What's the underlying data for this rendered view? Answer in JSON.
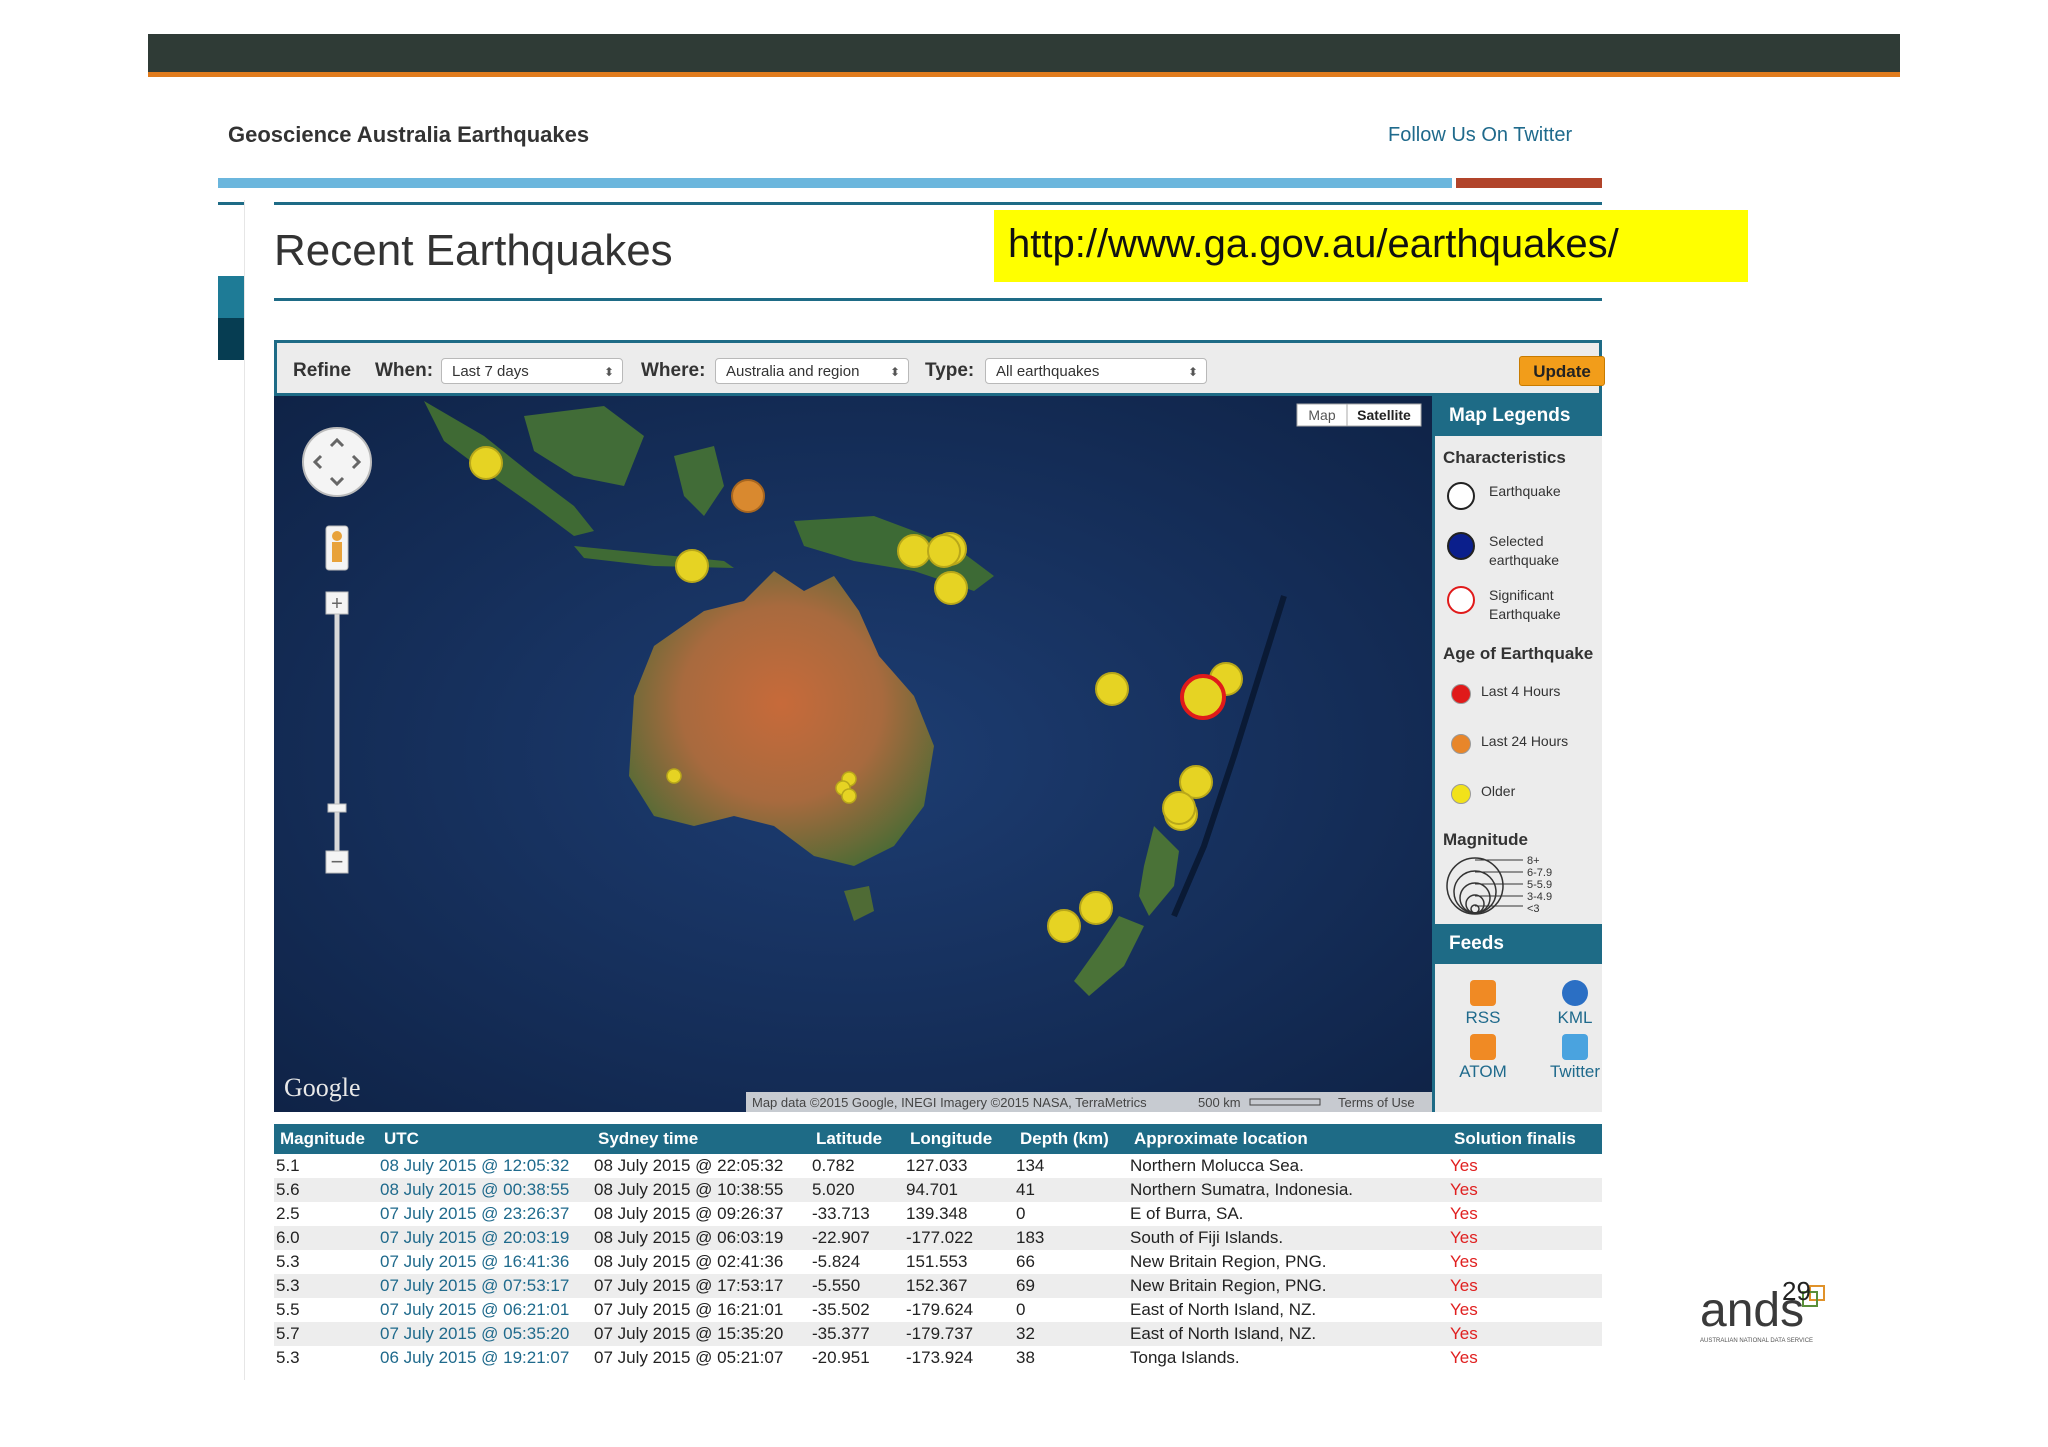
{
  "header": {
    "site_title": "Geoscience Australia Earthquakes",
    "follow_link": "Follow Us On Twitter"
  },
  "page": {
    "heading": "Recent Earthquakes",
    "url_callout": "http://www.ga.gov.au/earthquakes/"
  },
  "refine": {
    "label": "Refine",
    "when_label": "When:",
    "when_value": "Last 7 days",
    "where_label": "Where:",
    "where_value": "Australia and region",
    "type_label": "Type:",
    "type_value": "All earthquakes",
    "update_label": "Update"
  },
  "map": {
    "type_buttons": [
      "Map",
      "Satellite"
    ],
    "attribution": "Map data ©2015 Google, INEGI Imagery ©2015 NASA, TerraMetrics",
    "scale": "500 km",
    "terms": "Terms of Use",
    "brand": "Google",
    "zoom_in": "+",
    "zoom_out": "−"
  },
  "legend": {
    "title": "Map Legends",
    "characteristics_title": "Characteristics",
    "characteristics": [
      "Earthquake",
      "Selected earthquake",
      "Significant Earthquake"
    ],
    "age_title": "Age of Earthquake",
    "ages": [
      "Last 4 Hours",
      "Last 24 Hours",
      "Older"
    ],
    "magnitude_title": "Magnitude",
    "magnitude_levels": [
      "8+",
      "6-7.9",
      "5-5.9",
      "3-4.9",
      "<3"
    ],
    "feeds_title": "Feeds",
    "feeds": [
      "RSS",
      "KML",
      "ATOM",
      "Twitter"
    ]
  },
  "table": {
    "columns": [
      "Magnitude",
      "UTC",
      "Sydney time",
      "Latitude",
      "Longitude",
      "Depth (km)",
      "Approximate location",
      "Solution finalis"
    ],
    "rows": [
      [
        "5.1",
        "08 July 2015 @ 12:05:32",
        "08 July 2015 @ 22:05:32",
        "0.782",
        "127.033",
        "134",
        "Northern Molucca Sea.",
        "Yes"
      ],
      [
        "5.6",
        "08 July 2015 @ 00:38:55",
        "08 July 2015 @ 10:38:55",
        "5.020",
        "94.701",
        "41",
        "Northern Sumatra, Indonesia.",
        "Yes"
      ],
      [
        "2.5",
        "07 July 2015 @ 23:26:37",
        "08 July 2015 @ 09:26:37",
        "-33.713",
        "139.348",
        "0",
        "E of Burra, SA.",
        "Yes"
      ],
      [
        "6.0",
        "07 July 2015 @ 20:03:19",
        "08 July 2015 @ 06:03:19",
        "-22.907",
        "-177.022",
        "183",
        "South of Fiji Islands.",
        "Yes"
      ],
      [
        "5.3",
        "07 July 2015 @ 16:41:36",
        "08 July 2015 @ 02:41:36",
        "-5.824",
        "151.553",
        "66",
        "New Britain Region, PNG.",
        "Yes"
      ],
      [
        "5.3",
        "07 July 2015 @ 07:53:17",
        "07 July 2015 @ 17:53:17",
        "-5.550",
        "152.367",
        "69",
        "New Britain Region, PNG.",
        "Yes"
      ],
      [
        "5.5",
        "07 July 2015 @ 06:21:01",
        "07 July 2015 @ 16:21:01",
        "-35.502",
        "-179.624",
        "0",
        "East of North Island, NZ.",
        "Yes"
      ],
      [
        "5.7",
        "07 July 2015 @ 05:35:20",
        "07 July 2015 @ 15:35:20",
        "-35.377",
        "-179.737",
        "32",
        "East of North Island, NZ.",
        "Yes"
      ],
      [
        "5.3",
        "06 July 2015 @ 19:21:07",
        "07 July 2015 @ 05:21:07",
        "-20.951",
        "-173.924",
        "38",
        "Tonga Islands.",
        "Yes"
      ]
    ]
  },
  "footer": {
    "logo_text": "ands",
    "logo_subtitle": "AUSTRALIAN NATIONAL DATA SERVICE",
    "page_number": "29"
  },
  "colors": {
    "header_band": "#2f3b36",
    "accent_orange": "#e07b1d",
    "teal": "#1e6b86",
    "callout_yellow": "#ffff00",
    "quake_older": "#f2e21a",
    "quake_24h": "#e8862a",
    "quake_4h": "#e01a1a",
    "significant_ring": "#e01a1a"
  }
}
